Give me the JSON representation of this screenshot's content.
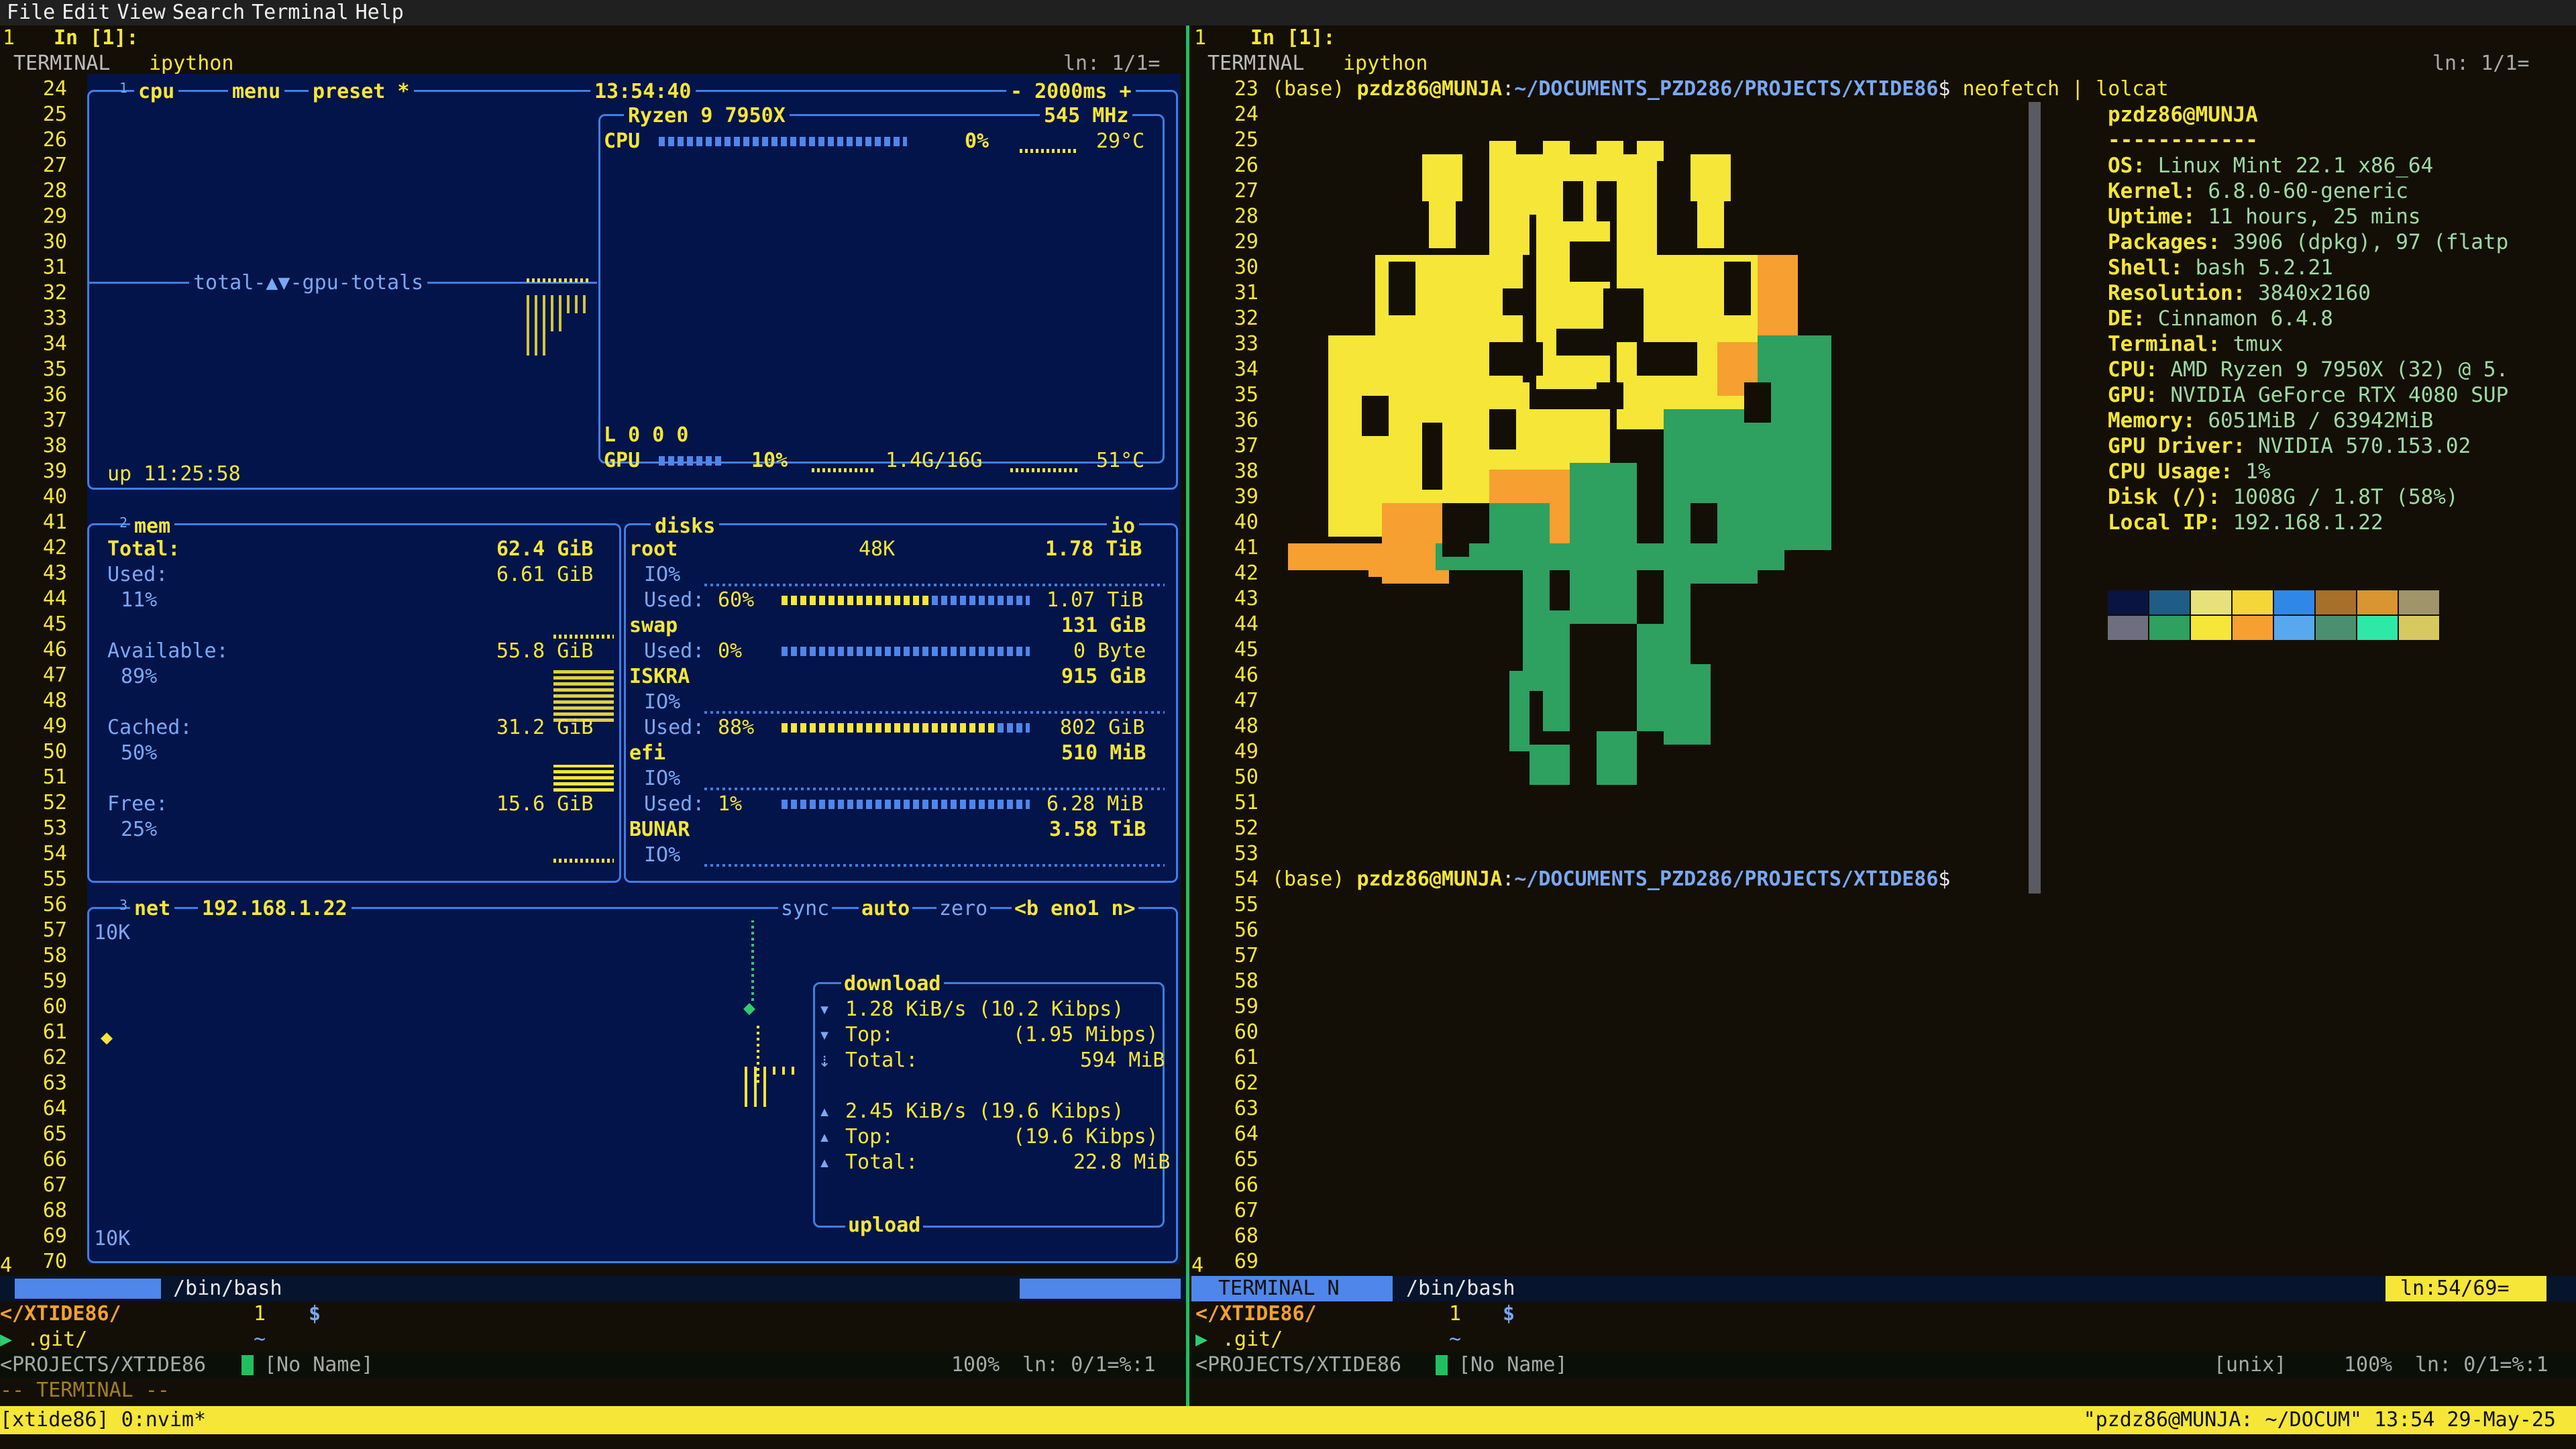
{
  "menu": [
    "File",
    "Edit",
    "View",
    "Search",
    "Terminal",
    "Help"
  ],
  "left_header": {
    "num": "1",
    "prompt": "In [1]:"
  },
  "right_header": {
    "num": "1",
    "prompt": "In [1]:"
  },
  "left_title": {
    "mode": "TERMINAL",
    "name": "ipython",
    "pos": "ln: 1/1="
  },
  "right_title": {
    "mode": "TERMINAL",
    "name": "ipython",
    "pos": "ln: 1/1="
  },
  "left_lines": [
    "24",
    "25",
    "26",
    "27",
    "28",
    "29",
    "30",
    "31",
    "32",
    "33",
    "34",
    "35",
    "36",
    "37",
    "38",
    "39",
    "40",
    "41",
    "42",
    "43",
    "44",
    "45",
    "46",
    "47",
    "48",
    "49",
    "50",
    "51",
    "52",
    "53",
    "54",
    "55",
    "56",
    "57",
    "58",
    "59",
    "60",
    "61",
    "62",
    "63",
    "64",
    "65",
    "66",
    "67",
    "68",
    "69",
    "70"
  ],
  "right_lines": [
    "23",
    "24",
    "25",
    "26",
    "27",
    "28",
    "29",
    "30",
    "31",
    "32",
    "33",
    "34",
    "35",
    "36",
    "37",
    "38",
    "39",
    "40",
    "41",
    "42",
    "43",
    "44",
    "45",
    "46",
    "47",
    "48",
    "49",
    "50",
    "51",
    "52",
    "53",
    "54",
    "55",
    "56",
    "57",
    "58",
    "59",
    "60",
    "61",
    "62",
    "63",
    "64",
    "65",
    "66",
    "67",
    "68",
    "69"
  ],
  "left_bottom_num": "4",
  "right_bottom_num": "4",
  "btop": {
    "cpu_tabs": [
      "cpu",
      "menu",
      "preset *"
    ],
    "cpu_tab_index": "1",
    "clock": "13:54:40",
    "interval": "- 2000ms +",
    "cpu_model": "Ryzen 9 7950X",
    "cpu_freq": "545 MHz",
    "cpu_label": "CPU",
    "cpu_pct": "0%",
    "cpu_temp": "29°C",
    "graph_label": "total-▲▼-gpu-totals",
    "load": "L 0 0 0",
    "gpu_label": "GPU",
    "gpu_pct": "10%",
    "gpu_mem": "1.4G/16G",
    "gpu_temp": "51°C",
    "uptime": "up 11:25:58",
    "cpu_usage_fraction": 0.0,
    "gpu_usage_fraction": 0.1,
    "mem": {
      "index": "2",
      "title": "mem",
      "total_label": "Total:",
      "total": "62.4 GiB",
      "used_label": "Used:",
      "used": "6.61 GiB",
      "used_pct": "11%",
      "avail_label": "Available:",
      "avail": "55.8 GiB",
      "avail_pct": "89%",
      "cached_label": "Cached:",
      "cached": "31.2 GiB",
      "cached_pct": "50%",
      "free_label": "Free:",
      "free": "15.6 GiB",
      "free_pct": "25%"
    },
    "disks": {
      "title": "disks",
      "io": "io",
      "root": {
        "name": "root",
        "speed": "48K",
        "size": "1.78 TiB",
        "io": "IO%",
        "used_label": "Used:",
        "used_pct": "60%",
        "used": "1.07 TiB",
        "fraction": 0.6
      },
      "swap": {
        "name": "swap",
        "size": "131 GiB",
        "used_label": "Used:",
        "used_pct": "0%",
        "used": "0 Byte",
        "fraction": 0.0
      },
      "iskra": {
        "name": "ISKRA",
        "size": "915 GiB",
        "io": "IO%",
        "used_label": "Used:",
        "used_pct": "88%",
        "used": "802 GiB",
        "fraction": 0.88
      },
      "efi": {
        "name": "efi",
        "size": "510 MiB",
        "io": "IO%",
        "used_label": "Used:",
        "used_pct": "1%",
        "used": "6.28 MiB",
        "fraction": 0.01
      },
      "bunar": {
        "name": "BUNAR",
        "size": "3.58 TiB",
        "io": "IO%"
      }
    },
    "net": {
      "index": "3",
      "title": "net",
      "ip": "192.168.1.22",
      "sync": "sync",
      "auto": "auto",
      "zero": "zero",
      "iface": "<b eno1 n>",
      "scale_top": "10K",
      "scale_bottom": "10K",
      "download_title": "download",
      "dl_rate": "1.28 KiB/s (10.2 Kibps)",
      "dl_top_label": "Top:",
      "dl_top": "(1.95 Mibps)",
      "dl_total_label": "Total:",
      "dl_total": "594 MiB",
      "ul_rate": "2.45 KiB/s (19.6 Kibps)",
      "ul_top_label": "Top:",
      "ul_top": "(19.6 Kibps)",
      "ul_total_label": "Total:",
      "ul_total": "22.8 MiB",
      "upload_title": "upload"
    }
  },
  "neofetch": {
    "prompt_env": "(base)",
    "prompt_user": "pzdz86@MUNJA",
    "prompt_path": "~/DOCUMENTS_PZD286/PROJECTS/XTIDE86",
    "command": "neofetch | lolcat",
    "title": "pzdz86@MUNJA",
    "underline": "------------",
    "fields": [
      {
        "k": "OS",
        "v": "Linux Mint 22.1 x86_64"
      },
      {
        "k": "Kernel",
        "v": "6.8.0-60-generic"
      },
      {
        "k": "Uptime",
        "v": "11 hours, 25 mins"
      },
      {
        "k": "Packages",
        "v": "3906 (dpkg), 97 (flatp"
      },
      {
        "k": "Shell",
        "v": "bash 5.2.21"
      },
      {
        "k": "Resolution",
        "v": "3840x2160"
      },
      {
        "k": "DE",
        "v": "Cinnamon 6.4.8"
      },
      {
        "k": "Terminal",
        "v": "tmux"
      },
      {
        "k": "CPU",
        "v": "AMD Ryzen 9 7950X (32) @ 5."
      },
      {
        "k": "GPU",
        "v": "NVIDIA GeForce RTX 4080 SUP"
      },
      {
        "k": "Memory",
        "v": "6051MiB / 63942MiB"
      },
      {
        "k": "GPU Driver",
        "v": "NVIDIA 570.153.02"
      },
      {
        "k": "CPU Usage",
        "v": "1%"
      },
      {
        "k": "Disk (/)",
        "v": "1008G / 1.8T (58%)"
      },
      {
        "k": "Local IP",
        "v": "192.168.1.22"
      }
    ],
    "palette_top": [
      "#0a1440",
      "#1f5d86",
      "#e8e07a",
      "#f5d638",
      "#2f88e8",
      "#a86f2a",
      "#d89530",
      "#a0956a"
    ],
    "palette_bottom": [
      "#6e6e80",
      "#2ea060",
      "#f5e637",
      "#f5a030",
      "#58a8f0",
      "#4a8f70",
      "#2ee8a8",
      "#d8c860"
    ]
  },
  "left_status": {
    "mode": "",
    "path": "/bin/bash"
  },
  "right_status": {
    "mode": "TERMINAL  N",
    "path": "/bin/bash",
    "pos": "ln:54/69="
  },
  "left_nvim": {
    "dir": "</XTIDE86/",
    "git": ".git/",
    "line1": "1",
    "line1b": "~",
    "dollar": "$",
    "file": "<PROJECTS/XTIDE86",
    "noname": "[No Name]",
    "pct": "100%",
    "pos": "ln: 0/1=%:1"
  },
  "right_nvim": {
    "dir": "</XTIDE86/",
    "git": ".git/",
    "line1": "1",
    "line1b": "~",
    "dollar": "$",
    "file": "<PROJECTS/XTIDE86",
    "noname": "[No Name]",
    "fmt": "[unix]",
    "pct": "100%",
    "pos": "ln: 0/1=%:1"
  },
  "terminal_mode": "-- TERMINAL --",
  "tmux": {
    "session": "[xtide86] 0:nvim*",
    "right": "\"pzdz86@MUNJA: ~/DOCUM\" 13:54 29-May-25"
  }
}
